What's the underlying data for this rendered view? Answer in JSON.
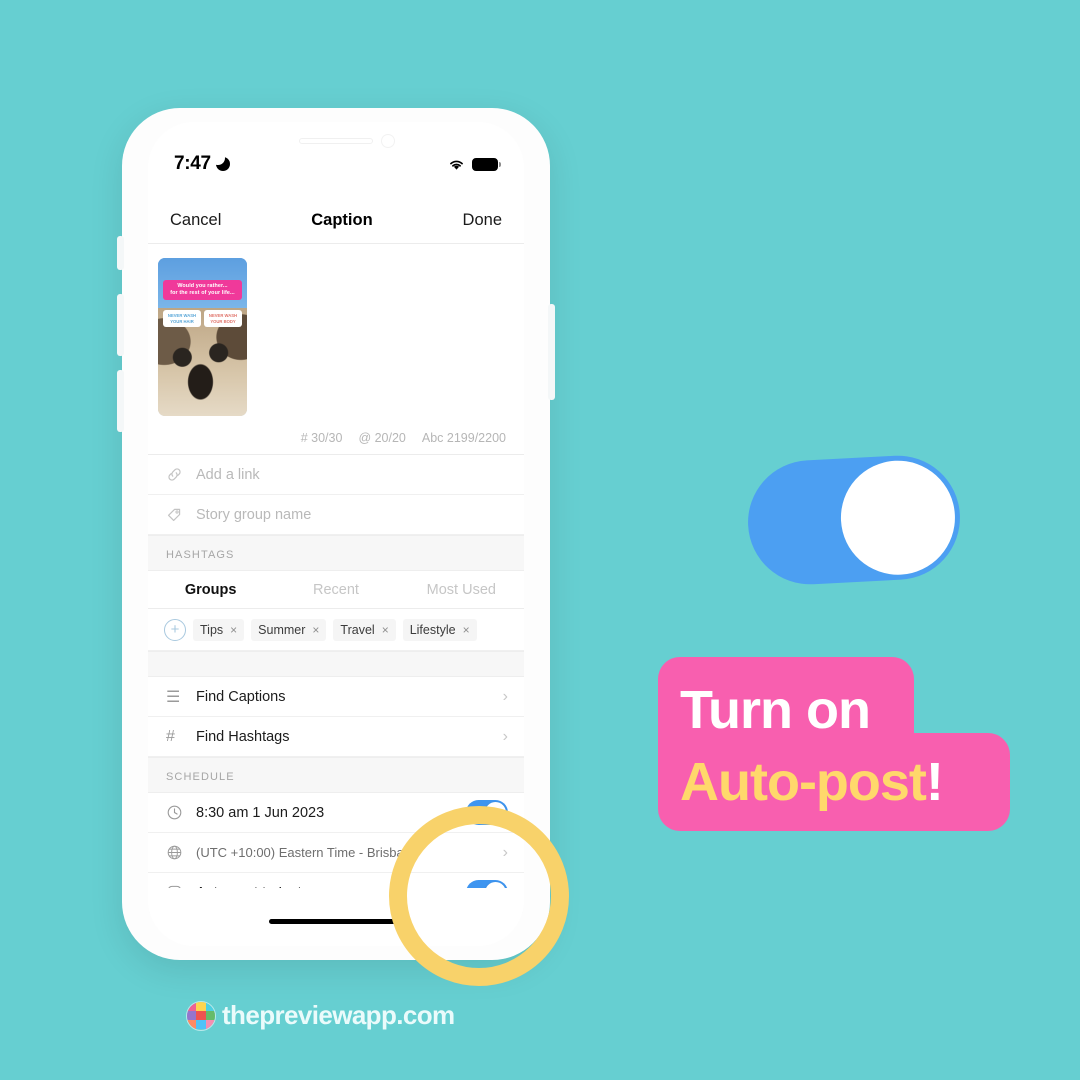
{
  "theme": {
    "background": "#66CFD1",
    "accent_blue": "#3E95F0",
    "highlight_yellow": "#F8D26A",
    "promo_pink": "#F85FAF",
    "promo_yellow": "#FFD86B"
  },
  "phone": {
    "status_bar": {
      "time": "7:47",
      "dnd_icon": "crescent-moon-icon",
      "wifi_icon": "wifi-icon",
      "battery_icon": "battery-full-icon"
    },
    "nav": {
      "cancel_label": "Cancel",
      "title": "Caption",
      "done_label": "Done"
    },
    "media": {
      "thumbnail_alt": "story-thumbnail",
      "sticker_line1": "Would you rather...",
      "sticker_line2": "for the rest of your life...",
      "poll_a_line1": "NEVER WASH",
      "poll_a_line2": "YOUR HAIR",
      "poll_b_line1": "NEVER WASH",
      "poll_b_line2": "YOUR BODY"
    },
    "counters": {
      "hashtags": "# 30/30",
      "mentions": "@ 20/20",
      "characters": "Abc 2199/2200"
    },
    "fields": [
      {
        "icon": "link-icon",
        "placeholder": "Add a link"
      },
      {
        "icon": "tag-icon",
        "placeholder": "Story group name"
      }
    ],
    "hashtags_section": {
      "label": "HASHTAGS",
      "tabs": [
        {
          "label": "Groups",
          "active": true
        },
        {
          "label": "Recent",
          "active": false
        },
        {
          "label": "Most Used",
          "active": false
        }
      ],
      "add_icon": "plus-circle-icon",
      "chips": [
        {
          "label": "Tips",
          "remove": "×"
        },
        {
          "label": "Summer",
          "remove": "×"
        },
        {
          "label": "Travel",
          "remove": "×"
        },
        {
          "label": "Lifestyle",
          "remove": "×"
        }
      ]
    },
    "find_rows": [
      {
        "icon": "list-lines-icon",
        "glyph": "☰",
        "label": "Find Captions",
        "chevron": "›"
      },
      {
        "icon": "hash-icon",
        "glyph": "#",
        "label": "Find Hashtags",
        "chevron": "›"
      }
    ],
    "schedule_section": {
      "label": "SCHEDULE",
      "rows": [
        {
          "icon": "clock-icon",
          "label": "8:30 am  1 Jun 2023",
          "control": "toggle",
          "toggle_on": true
        },
        {
          "icon": "globe-icon",
          "label": "(UTC +10:00) Eastern Time - Brisbane",
          "control": "chevron",
          "chevron": "›"
        },
        {
          "icon": "instagram-icon",
          "label": "Auto-post to Instagram",
          "control": "toggle",
          "toggle_on": true
        }
      ]
    },
    "home_indicator": "home-indicator"
  },
  "decor": {
    "highlight_ring": "highlight-ring",
    "big_toggle_state": "on"
  },
  "promo": {
    "line1": "Turn on",
    "line2": "Auto-post",
    "exclaim": "!"
  },
  "footer": {
    "site_name": "thepreviewapp.com",
    "logo": "preview-app-logo"
  }
}
